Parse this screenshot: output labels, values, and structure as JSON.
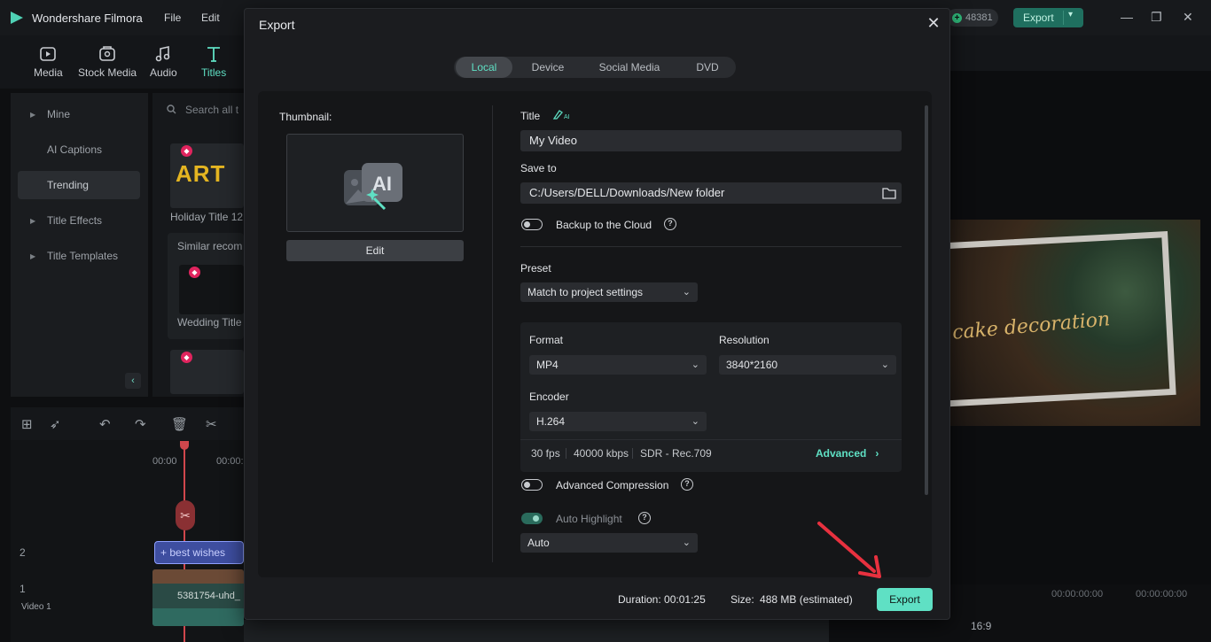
{
  "app": {
    "name": "Wondershare Filmora",
    "menu_file": "File",
    "menu_edit": "Edit",
    "credits": "48381",
    "export_label": "Export"
  },
  "top_tabs": [
    {
      "label": "Media",
      "icon": "media-icon"
    },
    {
      "label": "Stock Media",
      "icon": "stock-media-icon"
    },
    {
      "label": "Audio",
      "icon": "audio-icon"
    },
    {
      "label": "Titles",
      "icon": "titles-icon"
    }
  ],
  "sidebar": {
    "items": [
      {
        "label": "Mine"
      },
      {
        "label": "AI Captions"
      },
      {
        "label": "Trending"
      },
      {
        "label": "Title Effects"
      },
      {
        "label": "Title Templates"
      }
    ]
  },
  "library": {
    "search_placeholder": "Search all t",
    "card1_label": "Holiday Title 12",
    "card1_art": "ART",
    "similar_label": "Similar recom",
    "card2_label": "Wedding Title"
  },
  "preview": {
    "overlay_text": "cake decoration",
    "time_current": "00:00:00:00",
    "time_total": "00:00:00:00",
    "ratio": "16:9"
  },
  "timeline": {
    "ruler_1": "00:00",
    "ruler_2": "00:00:",
    "track2_label": "2",
    "track1_label": "1",
    "video_track_name": "Video 1",
    "title_clip": "+ best wishes",
    "video_clip": "5381754-uhd_"
  },
  "dialog": {
    "title": "Export",
    "tabs": [
      {
        "label": "Local"
      },
      {
        "label": "Device"
      },
      {
        "label": "Social Media"
      },
      {
        "label": "DVD"
      }
    ],
    "thumbnail_label": "Thumbnail:",
    "edit_label": "Edit",
    "title_label": "Title",
    "title_value": "My Video",
    "save_to_label": "Save to",
    "save_to_value": "C:/Users/DELL/Downloads/New folder",
    "backup_label": "Backup to the Cloud",
    "preset_label": "Preset",
    "preset_value": "Match to project settings",
    "format_label": "Format",
    "format_value": "MP4",
    "resolution_label": "Resolution",
    "resolution_value": "3840*2160",
    "encoder_label": "Encoder",
    "encoder_value": "H.264",
    "fps": "30 fps",
    "bitrate": "40000 kbps",
    "color_space": "SDR - Rec.709",
    "advanced_label": "Advanced",
    "advanced_compression_label": "Advanced Compression",
    "auto_highlight_label": "Auto Highlight",
    "auto_value": "Auto",
    "duration_label": "Duration:",
    "duration_value": "00:01:25",
    "size_label": "Size:",
    "size_value": "488 MB (estimated)",
    "export_label": "Export"
  },
  "colors": {
    "accent": "#5fe0c4",
    "arrow": "#e8313f"
  }
}
